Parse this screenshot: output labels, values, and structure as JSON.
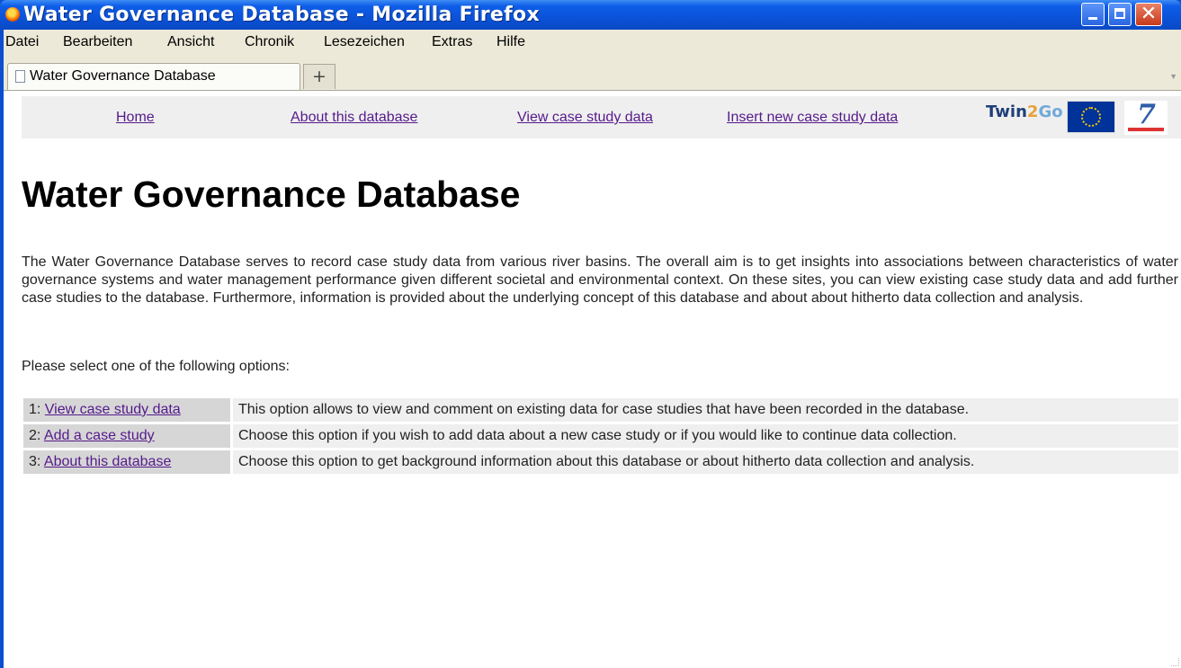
{
  "window": {
    "title": "Water Governance Database - Mozilla Firefox"
  },
  "menubar": {
    "items": [
      "Datei",
      "Bearbeiten",
      "Ansicht",
      "Chronik",
      "Lesezeichen",
      "Extras",
      "Hilfe"
    ]
  },
  "tabs": {
    "active_label": "Water Governance Database",
    "new_tab_symbol": "+"
  },
  "nav": {
    "home": "Home",
    "about": "About this database",
    "view": "View case study data",
    "insert": "Insert new case study data"
  },
  "logos": {
    "twin_a": "Twin",
    "twin_b": "2",
    "twin_c": "Go"
  },
  "main": {
    "title": "Water Governance Database",
    "intro": "The Water Governance Database serves to record case study data from various river basins. The overall aim is to get insights into associations between characteristics of water governance systems and water management performance given different societal and environmental context. On these sites, you can view existing case study data and add further case studies to the database. Furthermore, information is provided about the underlying concept of this database and about about hitherto data collection and analysis.",
    "prompt": "Please select one of the following options:",
    "options": [
      {
        "num": "1:",
        "link": "View case study data",
        "desc": "This option allows to view and comment on existing data for case studies that have been recorded in the database."
      },
      {
        "num": "2:",
        "link": "Add a case study",
        "desc": "Choose this option if you wish to add data about a new case study or if you would like to continue data collection."
      },
      {
        "num": "3:",
        "link": "About this database",
        "desc": "Choose this option to get background information about this database or about hitherto data collection and analysis."
      }
    ]
  },
  "colors": {
    "titlebar": "#0a52d8",
    "link": "#551a8b",
    "nav_bg": "#efefef"
  }
}
